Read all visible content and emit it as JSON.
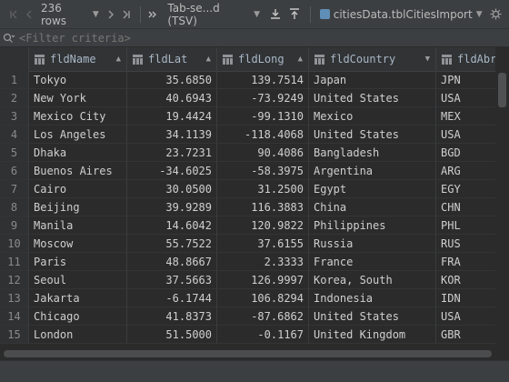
{
  "toolbar": {
    "rows_label": "236 rows",
    "format_label": "Tab-se...d (TSV)",
    "table_label": "citiesData.tblCitiesImport"
  },
  "filter": {
    "placeholder": "<Filter criteria>"
  },
  "columns": [
    "fldName",
    "fldLat",
    "fldLong",
    "fldCountry",
    "fldAbr"
  ],
  "rows": [
    [
      "1",
      "Tokyo",
      "35.6850",
      "139.7514",
      "Japan",
      "JPN"
    ],
    [
      "2",
      "New York",
      "40.6943",
      "-73.9249",
      "United States",
      "USA"
    ],
    [
      "3",
      "Mexico City",
      "19.4424",
      "-99.1310",
      "Mexico",
      "MEX"
    ],
    [
      "4",
      "Los Angeles",
      "34.1139",
      "-118.4068",
      "United States",
      "USA"
    ],
    [
      "5",
      "Dhaka",
      "23.7231",
      "90.4086",
      "Bangladesh",
      "BGD"
    ],
    [
      "6",
      "Buenos Aires",
      "-34.6025",
      "-58.3975",
      "Argentina",
      "ARG"
    ],
    [
      "7",
      "Cairo",
      "30.0500",
      "31.2500",
      "Egypt",
      "EGY"
    ],
    [
      "8",
      "Beijing",
      "39.9289",
      "116.3883",
      "China",
      "CHN"
    ],
    [
      "9",
      "Manila",
      "14.6042",
      "120.9822",
      "Philippines",
      "PHL"
    ],
    [
      "10",
      "Moscow",
      "55.7522",
      "37.6155",
      "Russia",
      "RUS"
    ],
    [
      "11",
      "Paris",
      "48.8667",
      "2.3333",
      "France",
      "FRA"
    ],
    [
      "12",
      "Seoul",
      "37.5663",
      "126.9997",
      "Korea, South",
      "KOR"
    ],
    [
      "13",
      "Jakarta",
      "-6.1744",
      "106.8294",
      "Indonesia",
      "IDN"
    ],
    [
      "14",
      "Chicago",
      "41.8373",
      "-87.6862",
      "United States",
      "USA"
    ],
    [
      "15",
      "London",
      "51.5000",
      "-0.1167",
      "United Kingdom",
      "GBR"
    ]
  ]
}
